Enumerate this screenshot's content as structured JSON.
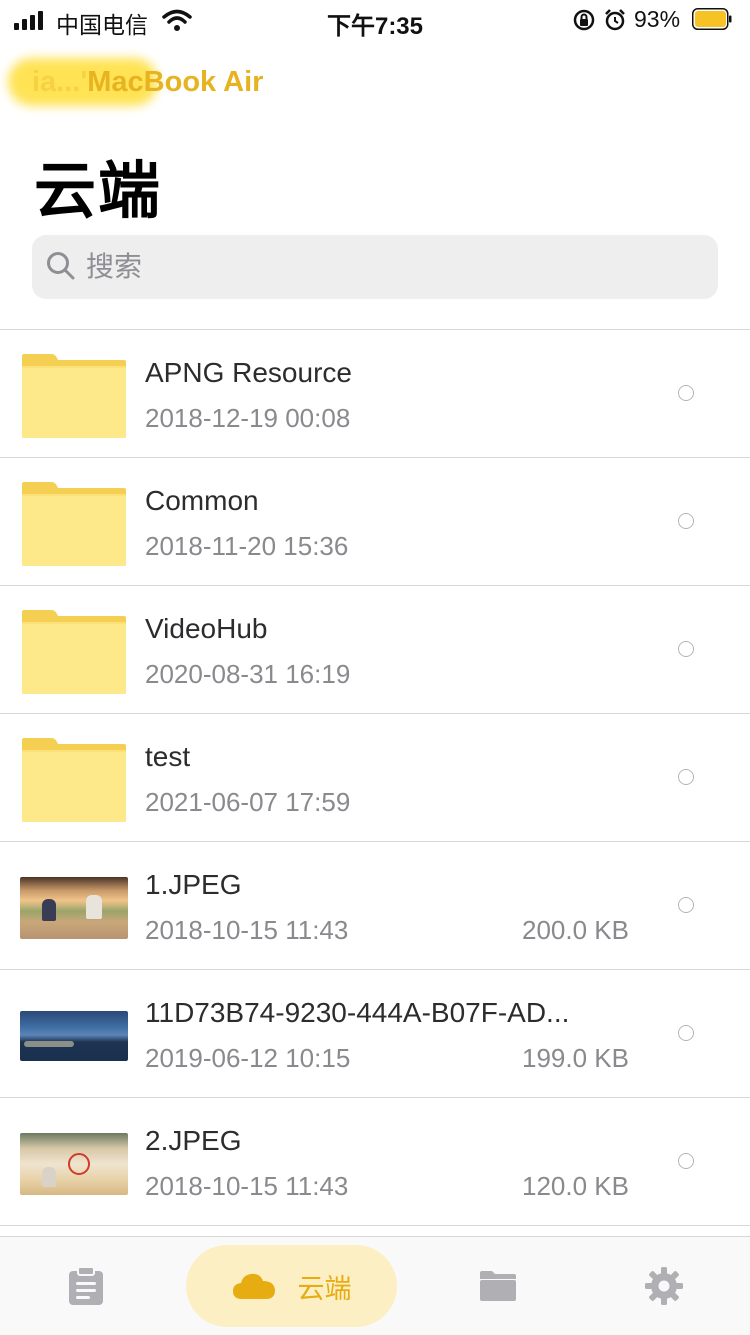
{
  "status_bar": {
    "carrier": "中国电信",
    "time": "下午7:35",
    "battery_percent": "93%",
    "battery_level": 0.93
  },
  "header": {
    "device_name": "MacBook Air",
    "title": "云端"
  },
  "search": {
    "placeholder": "搜索"
  },
  "files": [
    {
      "name": "APNG Resource",
      "date": "2018-12-19 00:08",
      "size": "",
      "kind": "folder"
    },
    {
      "name": "Common",
      "date": "2018-11-20 15:36",
      "size": "",
      "kind": "folder"
    },
    {
      "name": "VideoHub",
      "date": "2020-08-31 16:19",
      "size": "",
      "kind": "folder"
    },
    {
      "name": "test",
      "date": "2021-06-07 17:59",
      "size": "",
      "kind": "folder"
    },
    {
      "name": "1.JPEG",
      "date": "2018-10-15 11:43",
      "size": "200.0 KB",
      "kind": "image"
    },
    {
      "name": "11D73B74-9230-444A-B07F-AD...",
      "date": "2019-06-12 10:15",
      "size": "199.0 KB",
      "kind": "image"
    },
    {
      "name": "2.JPEG",
      "date": "2018-10-15 11:43",
      "size": "120.0 KB",
      "kind": "image"
    }
  ],
  "tab_bar": {
    "active_label": "云端",
    "tabs": [
      "clipboard-icon",
      "cloud-icon",
      "folder-icon",
      "gear-icon"
    ]
  },
  "colors": {
    "accent": "#e6ac12",
    "folder": "#fde98a",
    "active_tab_bg": "#fcefc4"
  }
}
